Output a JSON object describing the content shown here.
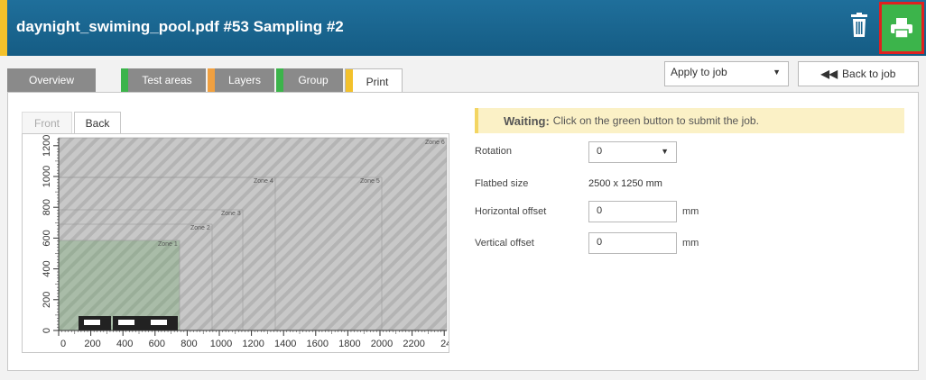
{
  "header": {
    "title": "daynight_swiming_pool.pdf #53 Sampling #2",
    "accent_color": "#f3c12b",
    "bg_color": "#1a6690",
    "trash_icon": "trash-icon",
    "print_icon": "printer-icon"
  },
  "tabs": [
    {
      "label": "Overview",
      "flag_color": ""
    },
    {
      "label": "Test areas",
      "flag_color": "#3cb44b"
    },
    {
      "label": "Layers",
      "flag_color": "#f0a040"
    },
    {
      "label": "Group",
      "flag_color": "#3cb44b"
    },
    {
      "label": "Print",
      "flag_color": "#f3c12b"
    }
  ],
  "toolbar": {
    "apply_select": "Apply to job",
    "back_button": "Back to job"
  },
  "preview": {
    "side_tabs": [
      "Front",
      "Back"
    ],
    "active_side": "Back",
    "x_ticks": [
      "0",
      "200",
      "400",
      "600",
      "800",
      "1000",
      "1200",
      "1400",
      "1600",
      "1800",
      "2000",
      "2200",
      "24"
    ],
    "y_ticks": [
      "0",
      "200",
      "400",
      "600",
      "800",
      "1000",
      "1200"
    ],
    "zones": [
      "Zone 1",
      "Zone 2",
      "Zone 3",
      "Zone 4",
      "Zone 5",
      "Zone 6"
    ]
  },
  "form": {
    "notice_bold": "Waiting:",
    "notice_text": "Click on the green button to submit the job.",
    "rotation_label": "Rotation",
    "rotation_value": "0",
    "flatbed_label": "Flatbed size",
    "flatbed_value": "2500 x 1250 mm",
    "h_offset_label": "Horizontal offset",
    "h_offset_value": "0",
    "v_offset_label": "Vertical offset",
    "v_offset_value": "0",
    "unit": "mm"
  }
}
